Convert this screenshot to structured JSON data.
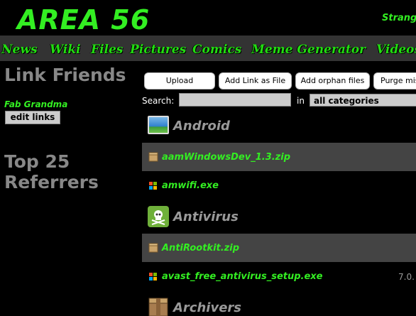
{
  "header": {
    "logo": "AREA 56",
    "right_link": "Strange"
  },
  "nav": {
    "items": [
      "News",
      "Wiki",
      "Files",
      "Pictures",
      "Comics",
      "Meme Generator",
      "Videos"
    ]
  },
  "sidebar": {
    "link_friends_title": "Link Friends",
    "user_name": "Fab Grandma",
    "edit_links_label": "edit links",
    "top_title_line1": "Top 25",
    "top_title_line2": "Referrers"
  },
  "toolbar": {
    "upload": "Upload",
    "add_link": "Add Link as File",
    "add_orphan": "Add orphan files",
    "purge": "Purge mis"
  },
  "search": {
    "label": "Search:",
    "value": "",
    "in_label": "in",
    "category_selected": "all categories"
  },
  "listing": {
    "android": {
      "category": "Android",
      "icon": "image-icon",
      "files": [
        {
          "name": "aamWindowsDev_1.3.zip",
          "icon": "package-icon"
        },
        {
          "name": "amwifi.exe",
          "icon": "windows-icon"
        }
      ]
    },
    "antivirus": {
      "category": "Antivirus",
      "icon": "skull-crossbones-icon",
      "files": [
        {
          "name": "AntiRootkit.zip",
          "icon": "package-icon"
        },
        {
          "name": "avast_free_antivirus_setup.exe",
          "icon": "windows-icon",
          "version": "7.0."
        }
      ]
    },
    "archivers": {
      "category": "Archivers",
      "icon": "package-icon"
    }
  },
  "colors": {
    "accent_green": "#33ee22",
    "nav_bg": "#333333",
    "row_dark": "#444444"
  }
}
